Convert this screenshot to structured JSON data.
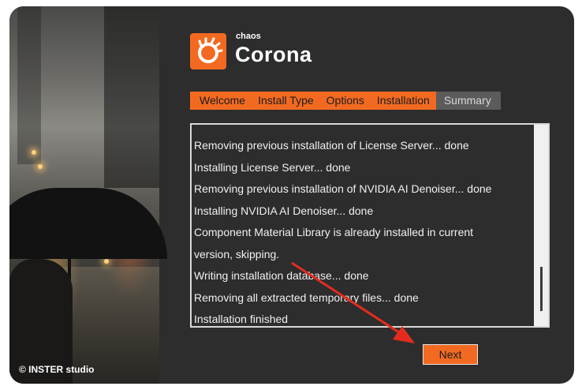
{
  "photo": {
    "caption": "© INSTER studio"
  },
  "logo": {
    "brand": "chaos",
    "product": "Corona",
    "icon": "corona-logo-icon"
  },
  "tabs": [
    {
      "label": "Welcome",
      "active": true
    },
    {
      "label": "Install Type",
      "active": true
    },
    {
      "label": "Options",
      "active": true
    },
    {
      "label": "Installation",
      "active": true
    },
    {
      "label": "Summary",
      "active": false
    }
  ],
  "log": {
    "lines": [
      "Removing previous installation of License Server... done",
      "Installing License Server... done",
      "Removing previous installation of NVIDIA AI Denoiser... done",
      "Installing NVIDIA AI Denoiser... done",
      "Component Material Library is already installed in current",
      "version, skipping.",
      "Writing installation database... done",
      "Removing all extracted temporary files... done",
      "Installation finished"
    ]
  },
  "buttons": {
    "next": "Next"
  },
  "colors": {
    "accent": "#f26a21",
    "window_bg": "#2d2d2d",
    "annotation_arrow": "#e32c1f"
  }
}
